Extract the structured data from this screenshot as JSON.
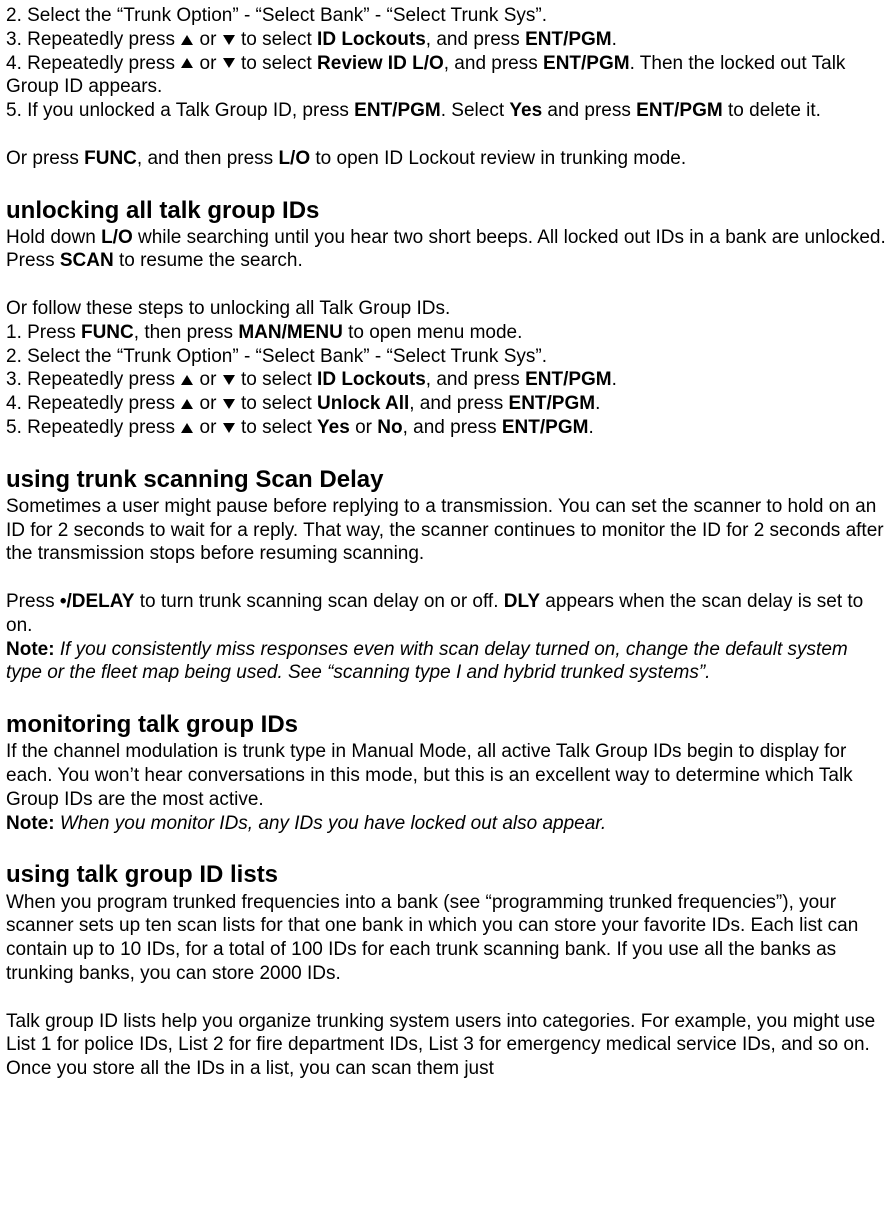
{
  "sectionA": {
    "step2": "2. Select the “Trunk Option” - “Select Bank” - “Select Trunk Sys”.",
    "step3_a": "3. Repeatedly press ",
    "step3_or": " or ",
    "step3_b": " to select ",
    "step3_bold": "ID Lockouts",
    "step3_c": ", and press ",
    "step3_ent": "ENT/PGM",
    "step3_d": ".",
    "step4_a": "4. Repeatedly press ",
    "step4_or": " or ",
    "step4_b": " to select ",
    "step4_bold": "Review ID L/O",
    "step4_c": ", and press ",
    "step4_ent": "ENT/PGM",
    "step4_d": ". Then the locked out Talk Group ID appears.",
    "step5_a": "5. If you unlocked a Talk Group ID, press ",
    "step5_ent1": "ENT/PGM",
    "step5_b": ". Select ",
    "step5_yes": "Yes",
    "step5_c": " and press ",
    "step5_ent2": "ENT/PGM",
    "step5_d": " to delete it.",
    "orpress_a": "Or press ",
    "orpress_func": "FUNC",
    "orpress_b": ", and then press ",
    "orpress_lo": "L/O",
    "orpress_c": " to open ID Lockout review in trunking mode."
  },
  "unlockAll": {
    "heading": "unlocking all talk group IDs",
    "intro_a": "Hold down ",
    "intro_lo": "L/O",
    "intro_b": " while searching until you hear two short beeps. All locked out IDs in a bank are unlocked. Press ",
    "intro_scan": "SCAN",
    "intro_c": " to resume the search.",
    "follow": "Or follow these steps to unlocking all Talk Group IDs.",
    "s1_a": "1. Press ",
    "s1_func": "FUNC",
    "s1_b": ", then press ",
    "s1_man": "MAN/MENU",
    "s1_c": " to open menu mode.",
    "s2": "2. Select the “Trunk Option” - “Select Bank” - “Select Trunk Sys”.",
    "s3_a": "3. Repeatedly press ",
    "s3_or": " or ",
    "s3_b": " to select ",
    "s3_bold": "ID Lockouts",
    "s3_c": ", and press ",
    "s3_ent": "ENT/PGM",
    "s3_d": ".",
    "s4_a": "4. Repeatedly press ",
    "s4_or": " or ",
    "s4_b": " to select ",
    "s4_bold": "Unlock All",
    "s4_c": ", and press ",
    "s4_ent": "ENT/PGM",
    "s4_d": ".",
    "s5_a": "5. Repeatedly press ",
    "s5_or": " or ",
    "s5_b": " to select ",
    "s5_yes": "Yes",
    "s5_orword": " or ",
    "s5_no": "No",
    "s5_c": ", and press ",
    "s5_ent": "ENT/PGM",
    "s5_d": "."
  },
  "scanDelay": {
    "heading": "using trunk scanning Scan Delay",
    "p1": "Sometimes a user might pause before replying to a transmission. You can set the scanner to hold on an ID for 2 seconds to wait for a reply. That way, the scanner continues to monitor the ID for 2 seconds after the transmission stops before resuming scanning.",
    "p2_a": "Press ",
    "p2_delay": "•/DELAY",
    "p2_b": " to turn trunk scanning scan delay on or off. ",
    "p2_dly": "DLY",
    "p2_c": " appears when the scan delay is set to on.",
    "note_label": "Note:",
    "note_body": " If you consistently miss responses even with scan delay turned on, change the default system type or the fleet map being used. See “scanning type I and hybrid trunked systems”."
  },
  "monitor": {
    "heading": "monitoring talk group IDs",
    "p1": "If the channel modulation is trunk type in Manual Mode, all active Talk Group IDs begin to display for each. You won’t hear conversations in this mode, but this is an excellent way to determine which Talk Group IDs are the most active.",
    "note_label": "Note:",
    "note_body": " When you monitor IDs, any IDs you have locked out also appear."
  },
  "lists": {
    "heading": "using talk group ID lists",
    "p1": "When you program trunked frequencies into a bank (see “programming trunked frequencies”), your scanner sets up ten scan lists for that one bank in which you can store your favorite IDs. Each list can contain up to 10 IDs, for a total of 100 IDs for each trunk scanning bank. If you use all the banks as trunking banks, you can store 2000 IDs.",
    "p2": "Talk group ID lists help you organize trunking system users into categories. For example, you might use List 1 for police IDs, List 2 for fire department IDs, List 3 for emergency medical service IDs, and so on. Once you store all the IDs in a list, you can scan them just"
  }
}
